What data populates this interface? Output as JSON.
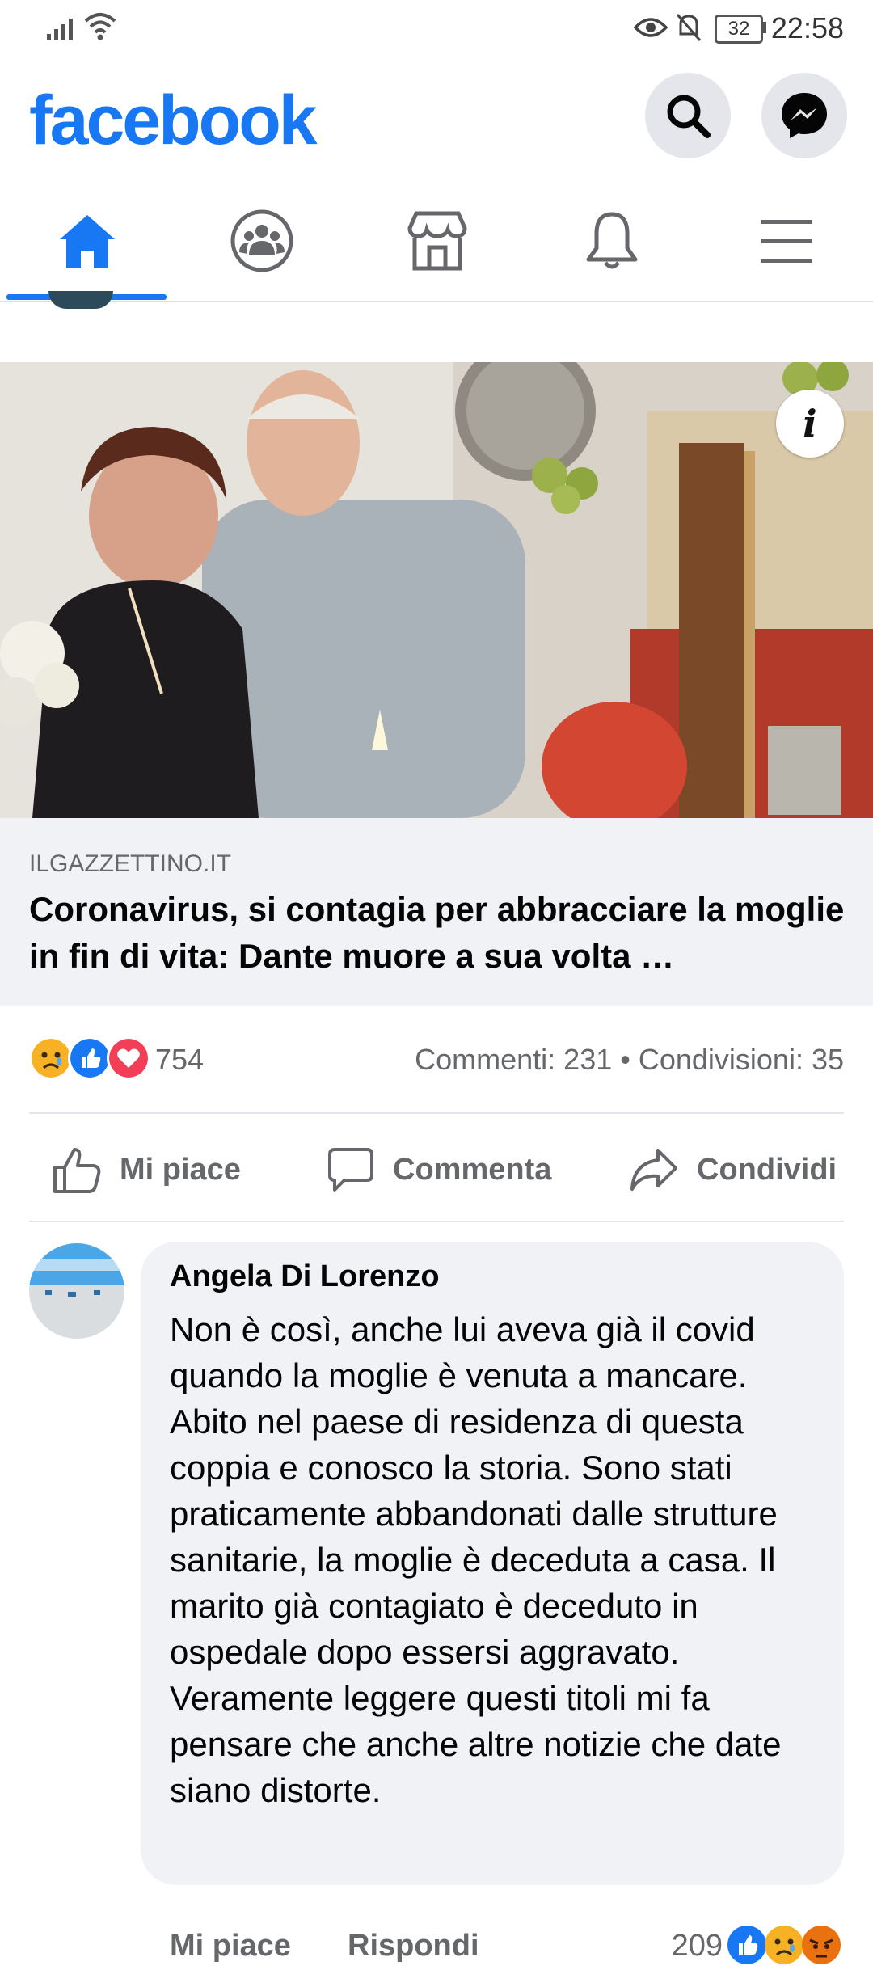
{
  "status_bar": {
    "time": "22:58",
    "battery": "32"
  },
  "header": {
    "logo": "facebook",
    "search_icon": "search-icon",
    "messenger_icon": "messenger-icon"
  },
  "tabs": [
    {
      "name": "home",
      "icon": "home-icon",
      "active": true
    },
    {
      "name": "groups",
      "icon": "groups-icon",
      "active": false
    },
    {
      "name": "marketplace",
      "icon": "marketplace-icon",
      "active": false
    },
    {
      "name": "notifications",
      "icon": "bell-icon",
      "active": false
    },
    {
      "name": "menu",
      "icon": "menu-icon",
      "active": false
    }
  ],
  "post": {
    "link_domain": "ILGAZZETTINO.IT",
    "link_title": "Coronavirus, si contagia per abbracciare la moglie in fin di vita: Dante muore a sua volta …",
    "reaction_count": "754",
    "comment_share_counts": "Commenti: 231 • Condivisioni: 35",
    "actions": {
      "like": "Mi piace",
      "comment": "Commenta",
      "share": "Condividi"
    }
  },
  "comment": {
    "author": "Angela Di Lorenzo",
    "text": "Non è così, anche lui aveva già il covid quando la moglie è venuta a mancare. Abito nel paese di residenza di questa coppia e conosco la storia. Sono stati praticamente abbandonati dalle strutture sanitarie, la moglie è deceduta a casa. Il marito già contagiato è deceduto in ospedale dopo essersi aggravato.\nVeramente leggere questi titoli mi fa pensare che anche altre notizie che date siano distorte.",
    "like_label": "Mi piace",
    "reply_label": "Rispondi",
    "reaction_count": "209"
  },
  "colors": {
    "brand": "#1877F2",
    "secondary_text": "#65676B",
    "bubble": "#F0F2F5"
  }
}
